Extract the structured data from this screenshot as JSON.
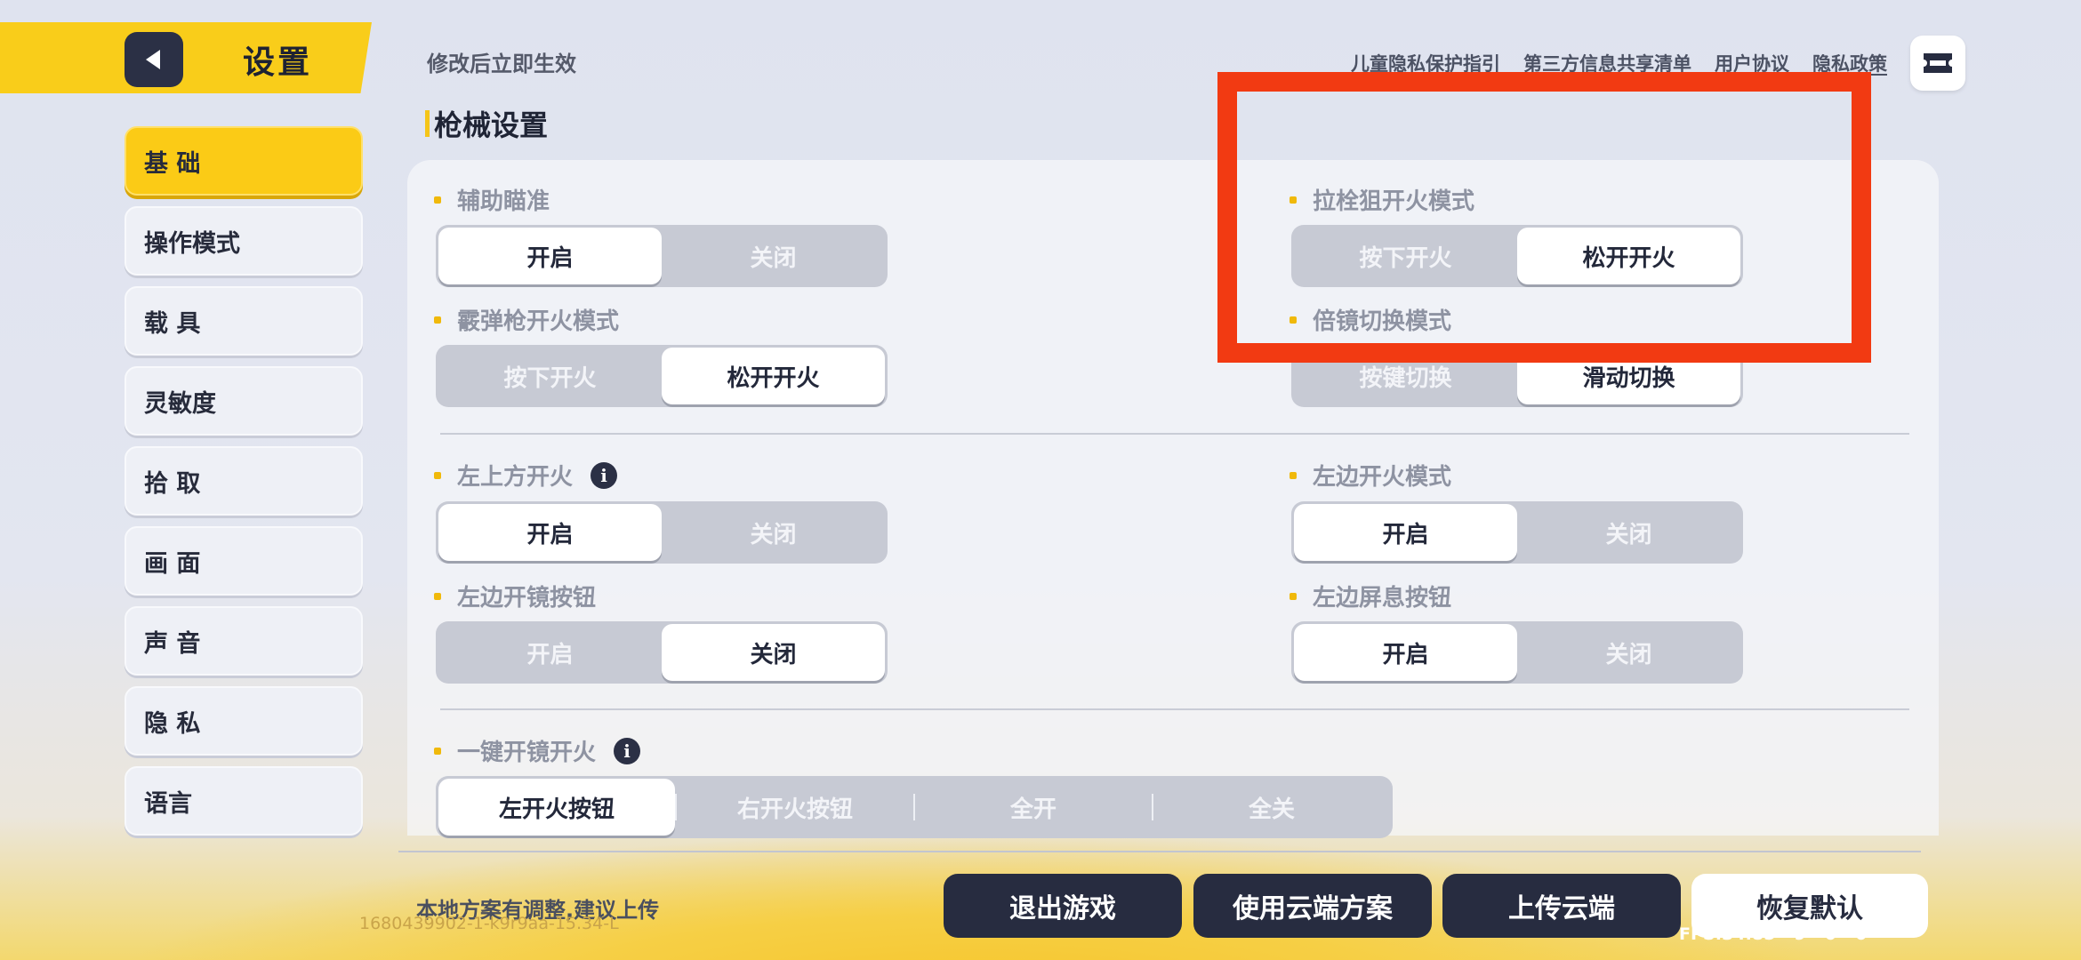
{
  "header": {
    "title": "设置",
    "notice": "修改后立即生效",
    "links": [
      "儿童隐私保护指引",
      "第三方信息共享清单",
      "用户协议",
      "隐私政策"
    ]
  },
  "sidebar": {
    "items": [
      {
        "label": "基 础",
        "active": true
      },
      {
        "label": "操作模式",
        "active": false
      },
      {
        "label": "载 具",
        "active": false
      },
      {
        "label": "灵敏度",
        "active": false
      },
      {
        "label": "拾 取",
        "active": false
      },
      {
        "label": "画 面",
        "active": false
      },
      {
        "label": "声 音",
        "active": false
      },
      {
        "label": "隐 私",
        "active": false
      },
      {
        "label": "语言",
        "active": false
      }
    ]
  },
  "section": {
    "title": "枪械设置"
  },
  "settings": {
    "aim_assist": {
      "label": "辅助瞄准",
      "options": [
        "开启",
        "关闭"
      ],
      "selected": 0
    },
    "shotgun_fire": {
      "label": "霰弹枪开火模式",
      "options": [
        "按下开火",
        "松开开火"
      ],
      "selected": 1
    },
    "bolt_sniper_fire": {
      "label": "拉栓狙开火模式",
      "options": [
        "按下开火",
        "松开开火"
      ],
      "selected": 1
    },
    "scope_switch": {
      "label": "倍镜切换模式",
      "options": [
        "按键切换",
        "滑动切换"
      ],
      "selected": 1
    },
    "top_left_fire": {
      "label": "左上方开火",
      "options": [
        "开启",
        "关闭"
      ],
      "selected": 0
    },
    "left_fire_mode": {
      "label": "左边开火模式",
      "options": [
        "开启",
        "关闭"
      ],
      "selected": 0
    },
    "left_scope_btn": {
      "label": "左边开镜按钮",
      "options": [
        "开启",
        "关闭"
      ],
      "selected": 1
    },
    "left_hold_breath_btn": {
      "label": "左边屏息按钮",
      "options": [
        "开启",
        "关闭"
      ],
      "selected": 0
    },
    "one_tap_scope_fire": {
      "label": "一键开镜开火",
      "options": [
        "左开火按钮",
        "右开火按钮",
        "全开",
        "全关"
      ],
      "selected": 0
    }
  },
  "footer": {
    "note": "本地方案有调整,建议上传",
    "build_id": "1680439902-1-k9r9aa-15.34-L",
    "fps": "FPS:34.85 - 9 - 0 - 0",
    "buttons": {
      "exit": "退出游戏",
      "use_cloud": "使用云端方案",
      "upload": "上传云端",
      "restore": "恢复默认"
    }
  },
  "colors": {
    "accent": "#f9cd1a",
    "dark": "#272c40",
    "highlight_box": "#f23a12"
  }
}
